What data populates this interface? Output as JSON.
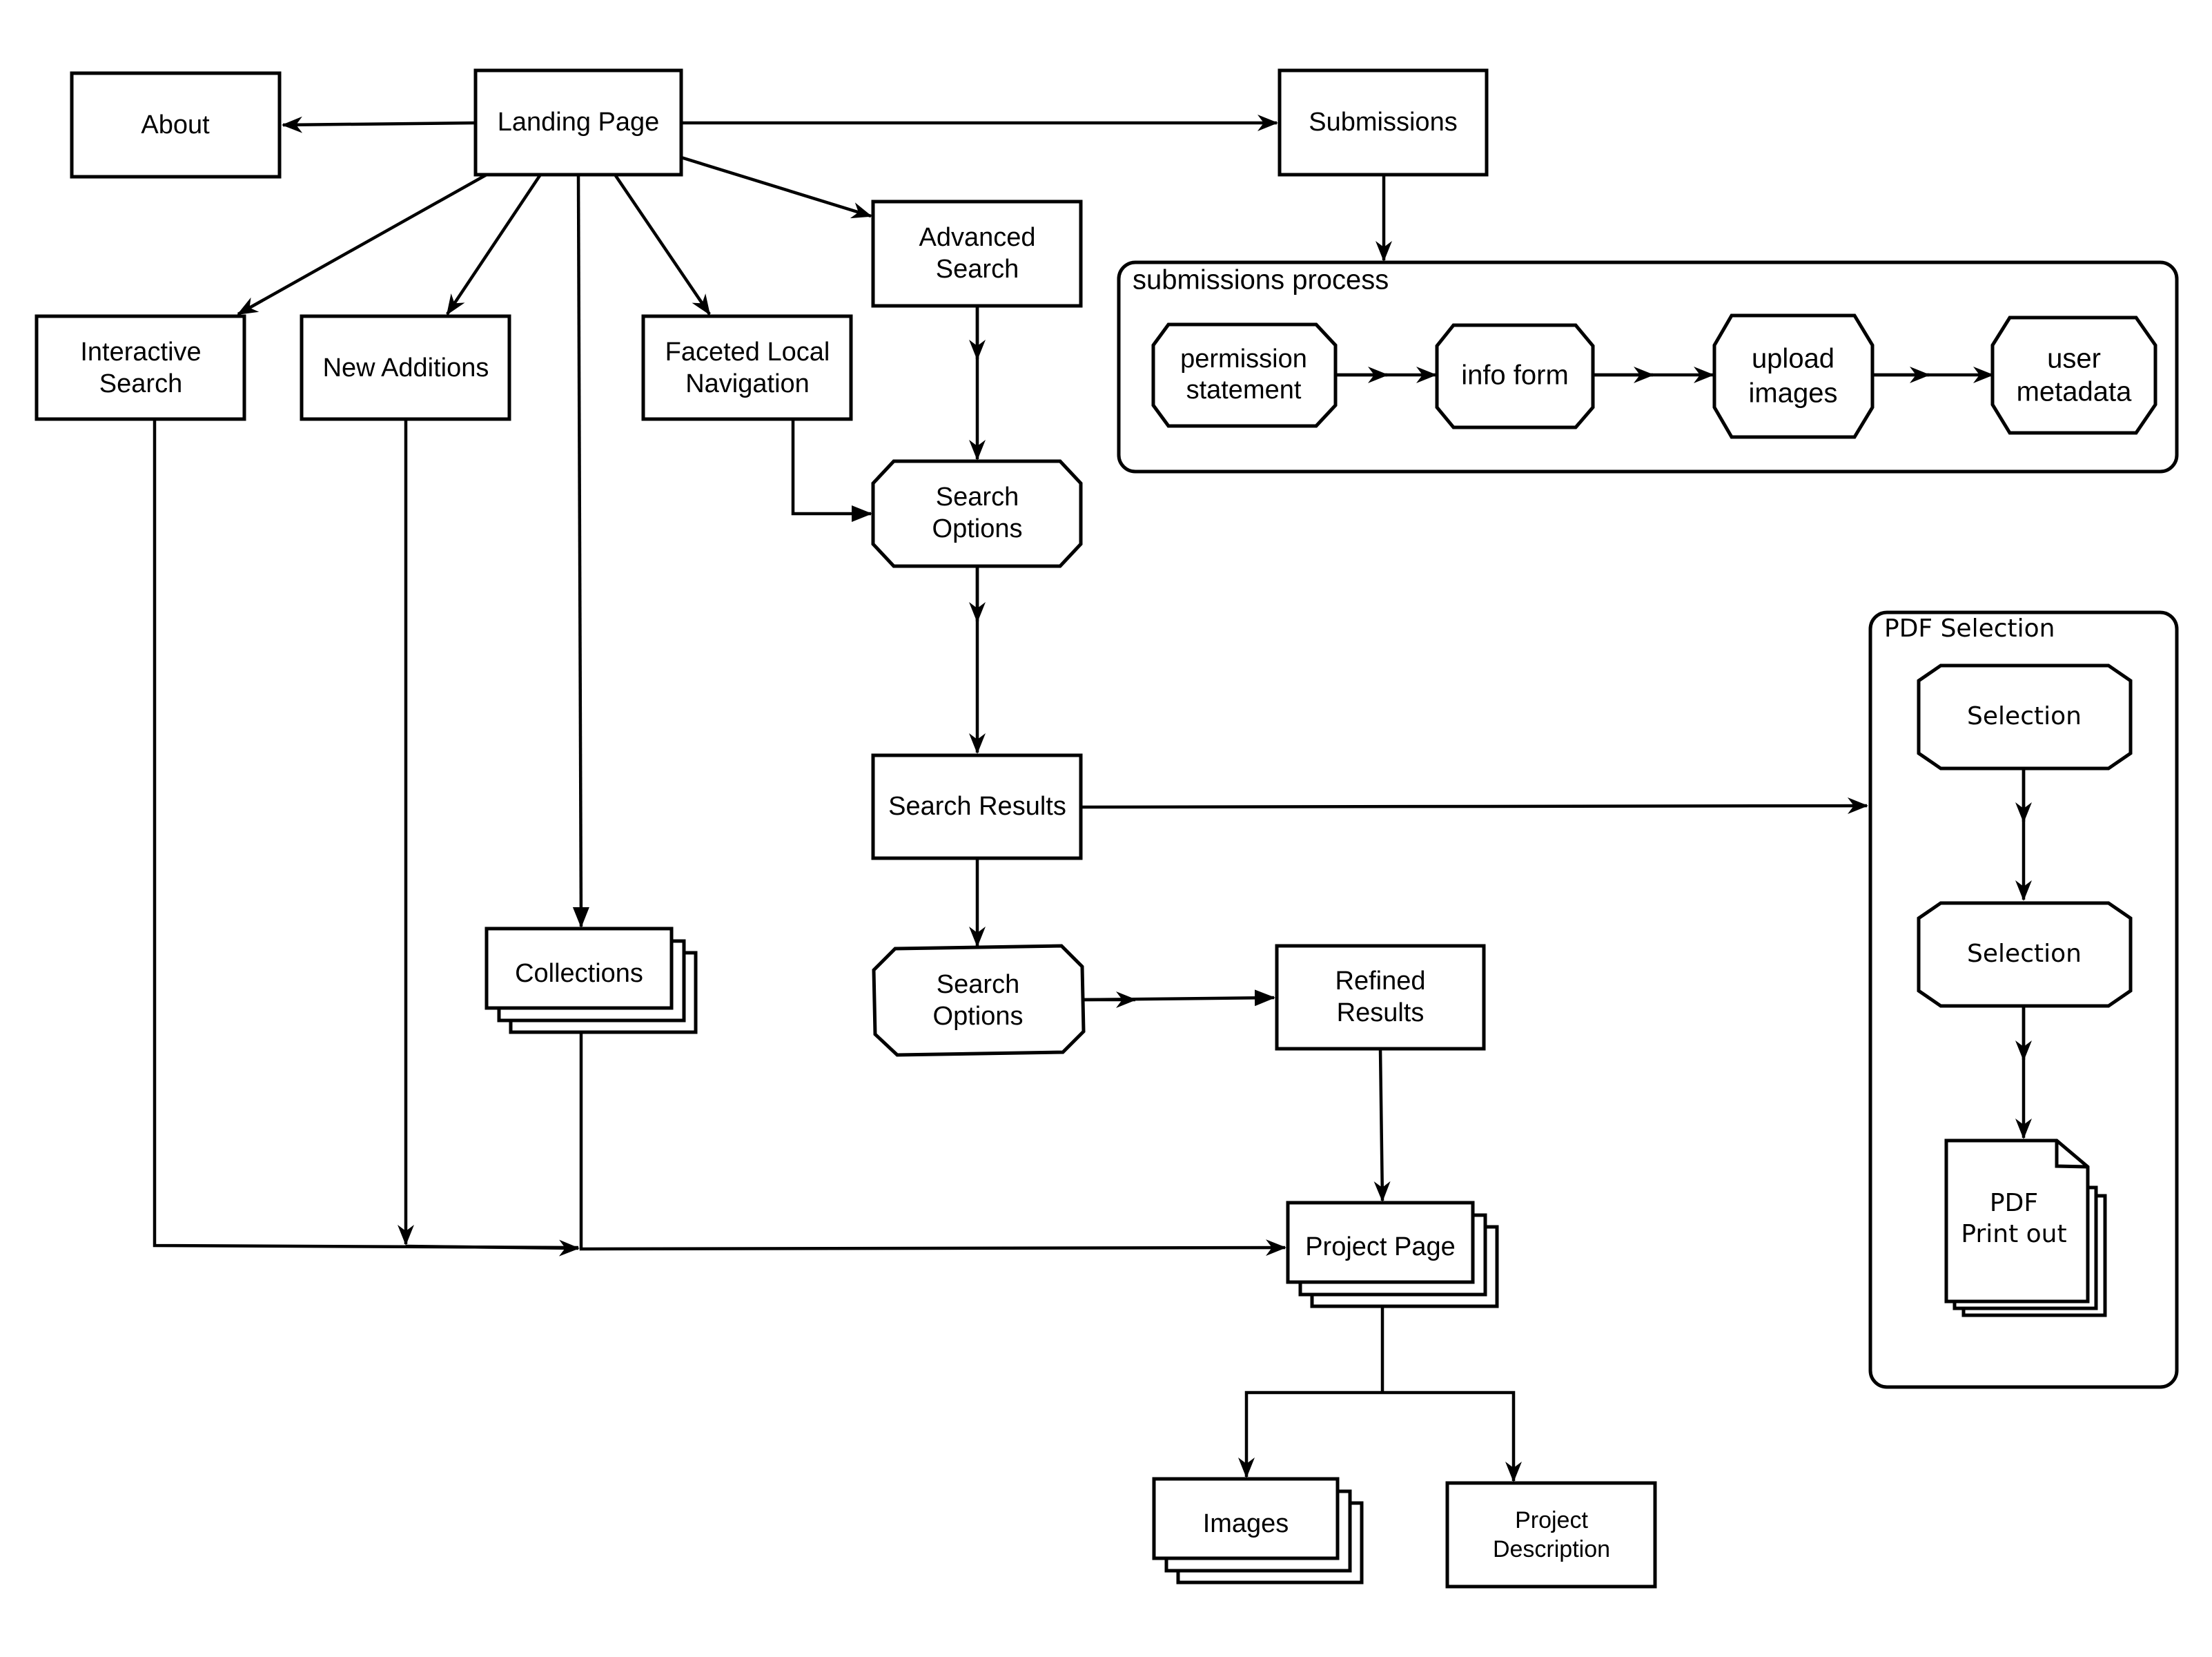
{
  "diagram": {
    "nodes": {
      "about": "About",
      "landing_page": "Landing Page",
      "submissions": "Submissions",
      "advanced_search": [
        "Advanced",
        "Search"
      ],
      "interactive_search": [
        "Interactive",
        "Search"
      ],
      "new_additions": "New Additions",
      "faceted_nav": [
        "Faceted Local",
        "Navigation"
      ],
      "search_options_1": [
        "Search",
        "Options"
      ],
      "search_results": "Search Results",
      "search_options_2": [
        "Search",
        "Options"
      ],
      "refined_results": [
        "Refined",
        "Results"
      ],
      "collections": "Collections",
      "project_page": "Project Page",
      "images": "Images",
      "project_description": [
        "Project",
        "Description"
      ]
    },
    "submissions_group": {
      "title": "submissions process",
      "steps": [
        [
          "permission",
          "statement"
        ],
        [
          "info form"
        ],
        [
          "upload",
          "images"
        ],
        [
          "user",
          "metadata"
        ]
      ]
    },
    "pdf_group": {
      "title": "PDF Selection",
      "selection_1": "Selection",
      "selection_2": "Selection",
      "printout": [
        "PDF",
        "Print out"
      ]
    },
    "edges": [
      {
        "from": "Landing Page",
        "to": "About"
      },
      {
        "from": "Landing Page",
        "to": "Submissions"
      },
      {
        "from": "Landing Page",
        "to": "Advanced Search"
      },
      {
        "from": "Landing Page",
        "to": "Interactive Search"
      },
      {
        "from": "Landing Page",
        "to": "New Additions"
      },
      {
        "from": "Landing Page",
        "to": "Faceted Local Navigation"
      },
      {
        "from": "Landing Page",
        "to": "Collections"
      },
      {
        "from": "Submissions",
        "to": "submissions process"
      },
      {
        "from": "permission statement",
        "to": "info form"
      },
      {
        "from": "info form",
        "to": "upload images"
      },
      {
        "from": "upload images",
        "to": "user metadata"
      },
      {
        "from": "Advanced Search",
        "to": "Search Options"
      },
      {
        "from": "Faceted Local Navigation",
        "to": "Search Options"
      },
      {
        "from": "Search Options",
        "to": "Search Results"
      },
      {
        "from": "Search Results",
        "to": "PDF Selection"
      },
      {
        "from": "Search Results",
        "to": "Search Options (refine)"
      },
      {
        "from": "Search Options (refine)",
        "to": "Refined Results"
      },
      {
        "from": "Refined Results",
        "to": "Project Page"
      },
      {
        "from": "Interactive Search",
        "to": "Project Page"
      },
      {
        "from": "New Additions",
        "to": "Project Page"
      },
      {
        "from": "Collections",
        "to": "Project Page"
      },
      {
        "from": "Project Page",
        "to": "Images"
      },
      {
        "from": "Project Page",
        "to": "Project Description"
      },
      {
        "from": "Selection",
        "to": "Selection"
      },
      {
        "from": "Selection",
        "to": "PDF Print out"
      }
    ]
  }
}
